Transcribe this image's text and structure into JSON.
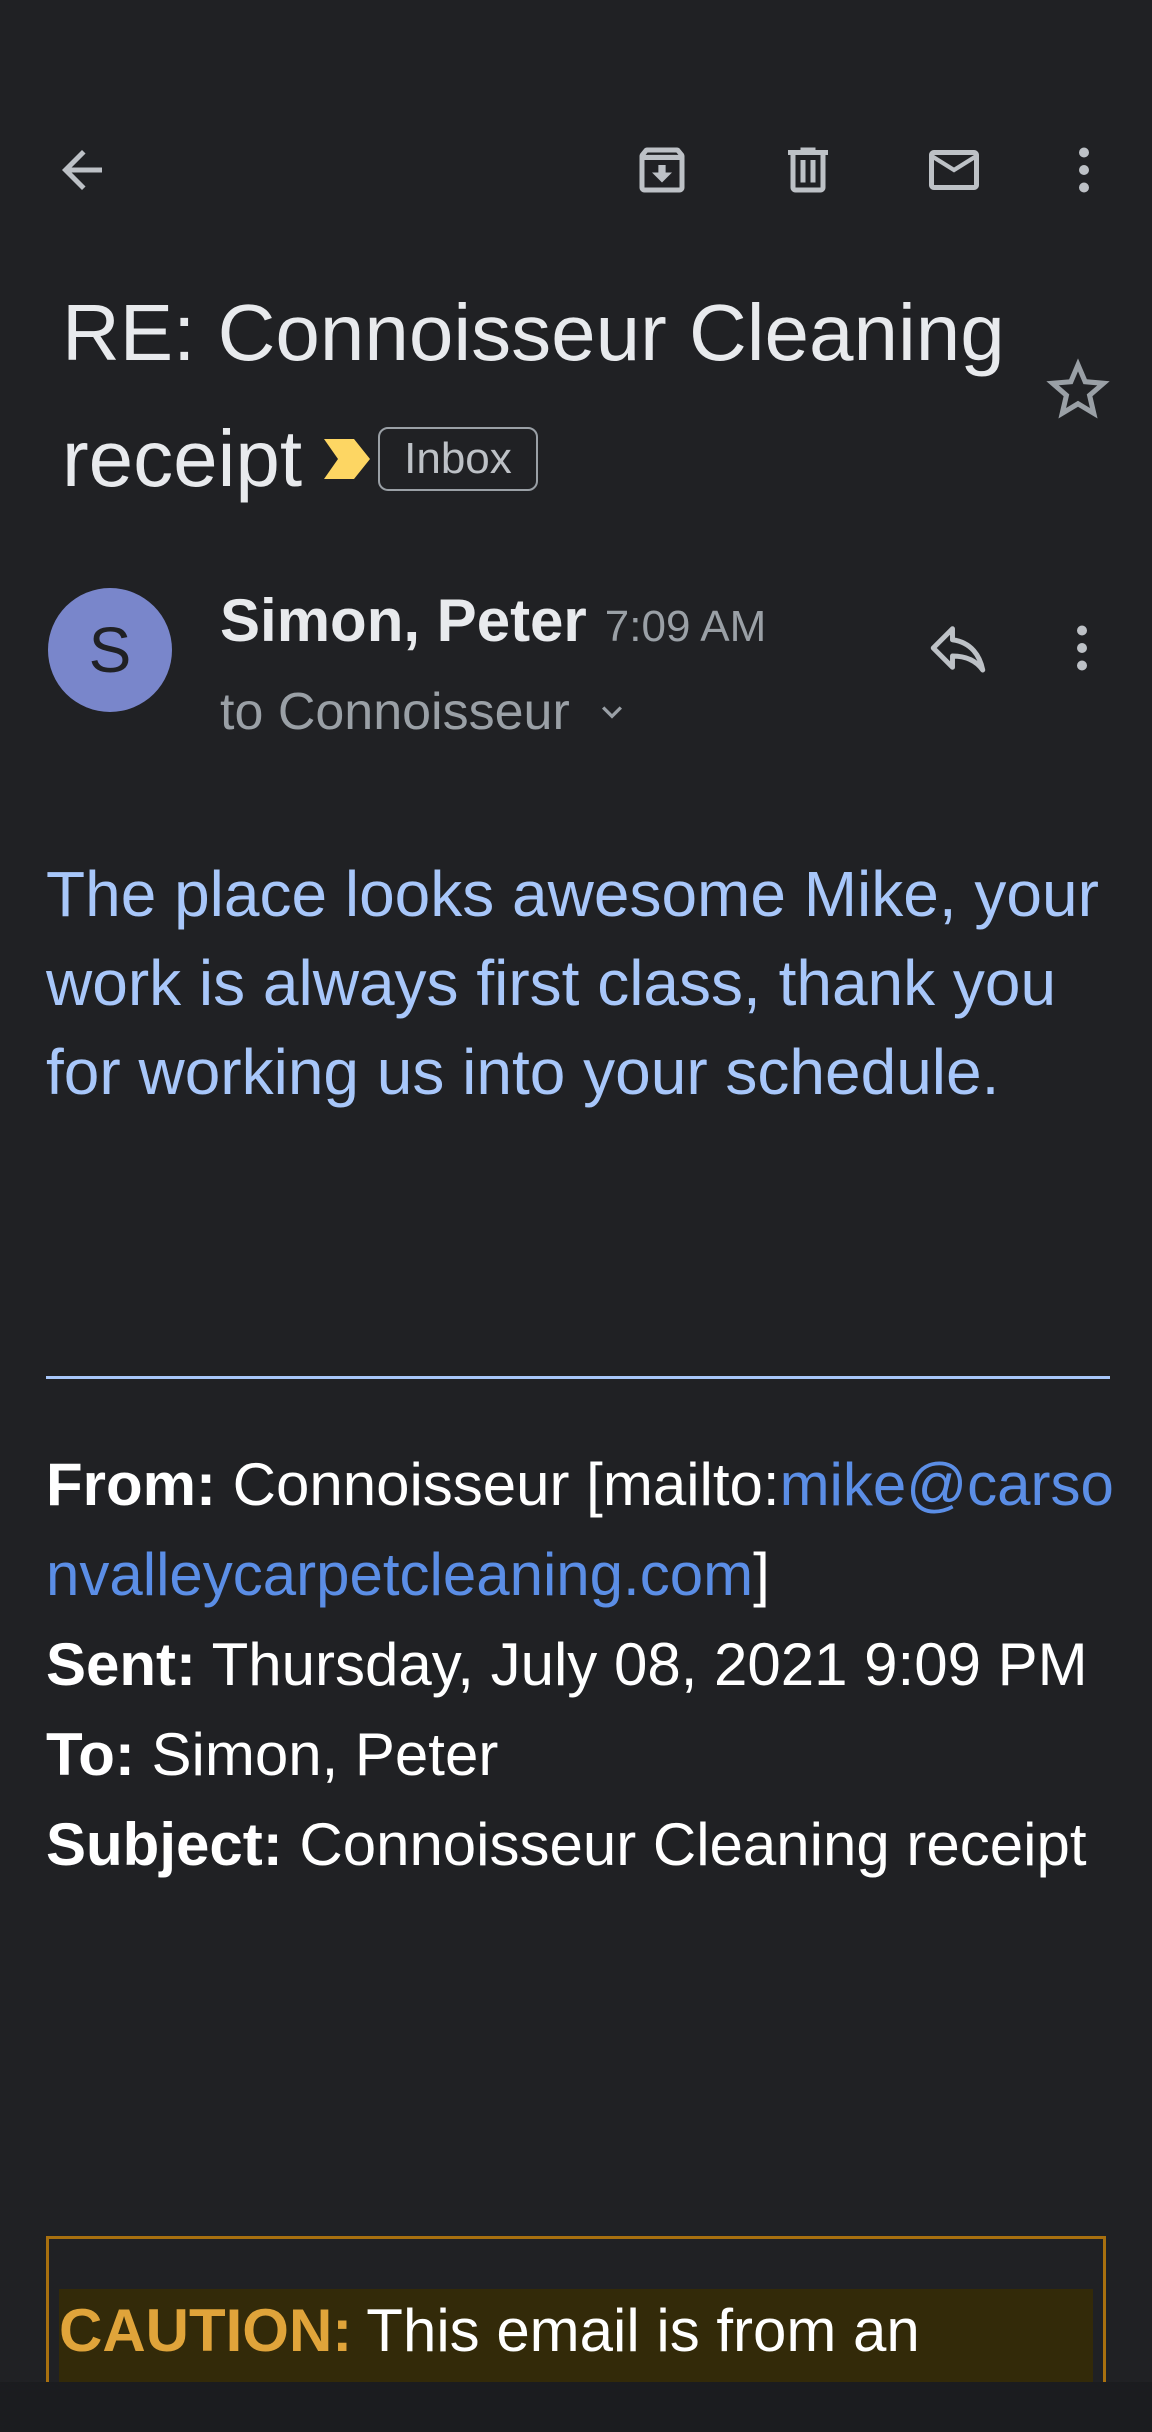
{
  "toolbar": {
    "back_icon": "arrow-back-icon",
    "archive_icon": "archive-icon",
    "delete_icon": "trash-icon",
    "mark_unread_icon": "mail-icon",
    "more_icon": "more-vert-icon"
  },
  "email": {
    "subject": "RE: Connoisseur Cleaning receipt",
    "label": "Inbox",
    "sender_initial": "S",
    "sender_name": "Simon, Peter",
    "time": "7:09 AM",
    "to_line": "to Connoisseur",
    "body": "The place looks awesome Mike, your work is always first class, thank you for working us into your schedule."
  },
  "quoted": {
    "from_label": "From:",
    "from_text": " Connoisseur [mailto:",
    "from_link": "mike@carsonvalleycarpetcleaning.com",
    "from_end": "]",
    "sent_label": "Sent:",
    "sent_text": " Thursday, July 08, 2021 9:09 PM",
    "to_label": "To:",
    "to_text": " Simon, Peter",
    "subject_label": "Subject:",
    "subject_text": " Connoisseur Cleaning receipt"
  },
  "caution": {
    "label": "CAUTION:",
    "text": "This email is from an"
  },
  "colors": {
    "background": "#202124",
    "body_text": "#a8c7fa",
    "link": "#5b8ee6",
    "avatar": "#7986cb",
    "importance": "#fdd663",
    "caution_border": "#a8700f",
    "caution_label": "#e0a43a"
  }
}
